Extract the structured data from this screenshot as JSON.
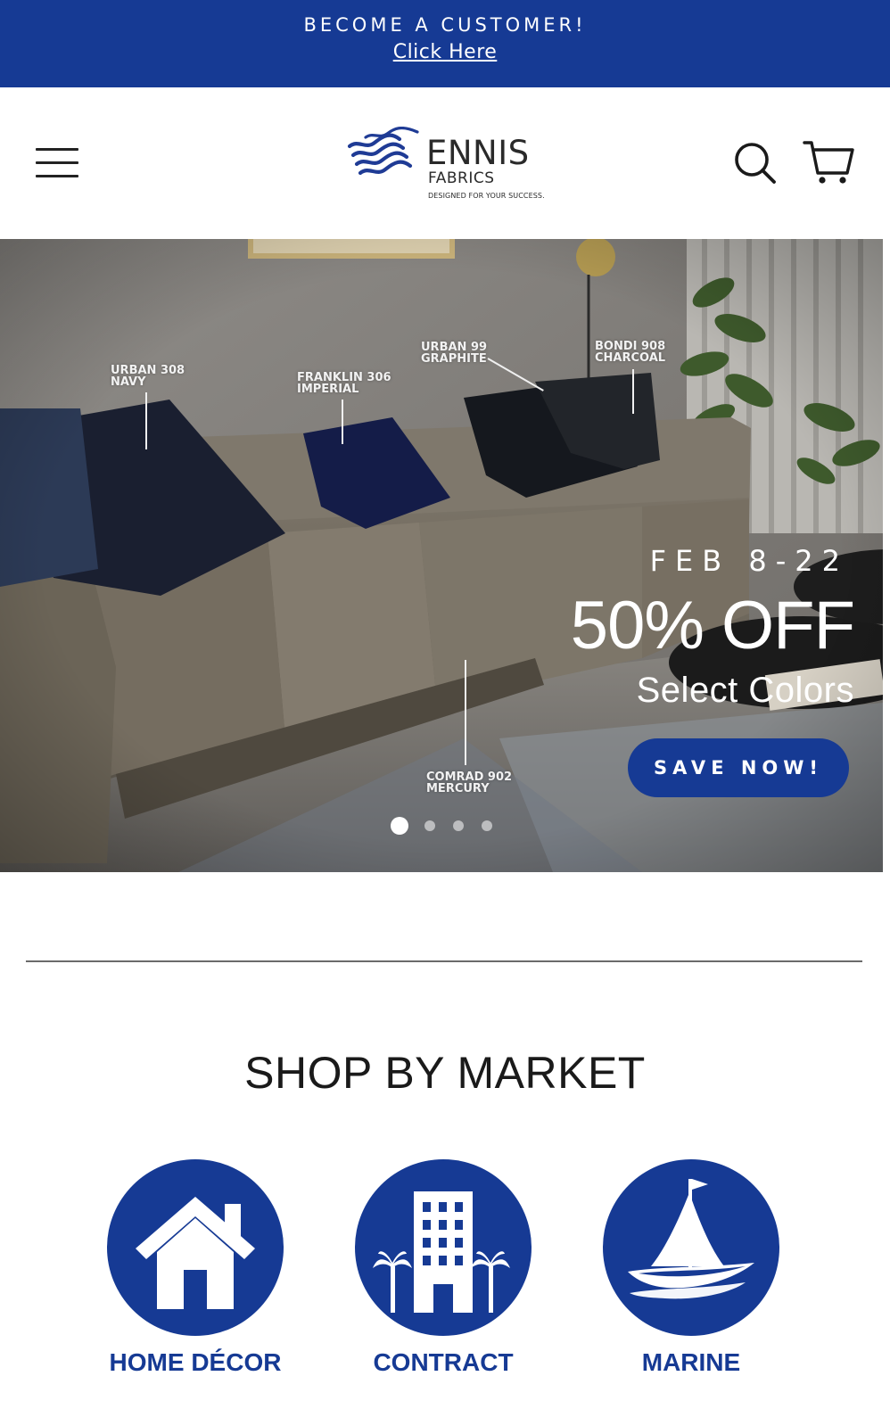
{
  "announcement": {
    "headline": "BECOME A CUSTOMER!",
    "link_text": "Click Here"
  },
  "header": {
    "menu_icon": "hamburger-menu-icon",
    "logo": {
      "brand": "ENNIS",
      "sub": "FABRICS",
      "tagline": "DESIGNED FOR YOUR SUCCESS."
    },
    "search_icon": "search-icon",
    "cart_icon": "cart-icon"
  },
  "hero": {
    "fabric_labels": [
      {
        "line1": "URBAN 308",
        "line2": "NAVY"
      },
      {
        "line1": "FRANKLIN 306",
        "line2": "IMPERIAL"
      },
      {
        "line1": "URBAN 99",
        "line2": "GRAPHITE"
      },
      {
        "line1": "BONDI 908",
        "line2": "CHARCOAL"
      },
      {
        "line1": "COMRAD 902",
        "line2": "MERCURY"
      }
    ],
    "promo_date": "FEB 8-22",
    "promo_headline": "50% OFF",
    "promo_sub": "Select Colors",
    "cta_label": "SAVE NOW!",
    "slides_total": 4,
    "active_slide": 1
  },
  "shop_by_market": {
    "title": "SHOP BY MARKET",
    "items": [
      {
        "label": "HOME DÉCOR",
        "icon": "house-icon"
      },
      {
        "label": "CONTRACT",
        "icon": "building-palm-icon"
      },
      {
        "label": "MARINE",
        "icon": "sailboat-icon"
      }
    ]
  },
  "colors": {
    "brand_blue": "#163a94",
    "white": "#ffffff"
  }
}
